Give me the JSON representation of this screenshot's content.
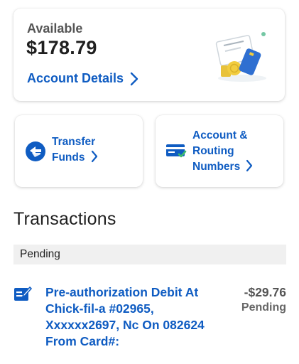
{
  "account": {
    "available_label": "Available",
    "balance": "$178.79",
    "details_link": "Account Details"
  },
  "actions": [
    {
      "line1": "Transfer",
      "line2": "Funds",
      "icon": "transfer-arrows-icon"
    },
    {
      "line1": "Account &",
      "line2": "Routing",
      "line3": "Numbers",
      "icon": "card-check-icon"
    }
  ],
  "transactions": {
    "title": "Transactions",
    "pending_header": "Pending",
    "items": [
      {
        "description": "Pre-authorization Debit At Chick-fil-a #02965, Xxxxxx2697, Nc On 082624 From Card#:",
        "amount": "-$29.76",
        "status": "Pending",
        "icon": "card-transaction-icon"
      }
    ]
  },
  "colors": {
    "link_blue": "#0f5cc2",
    "pending_bg": "#f0f0f0"
  }
}
